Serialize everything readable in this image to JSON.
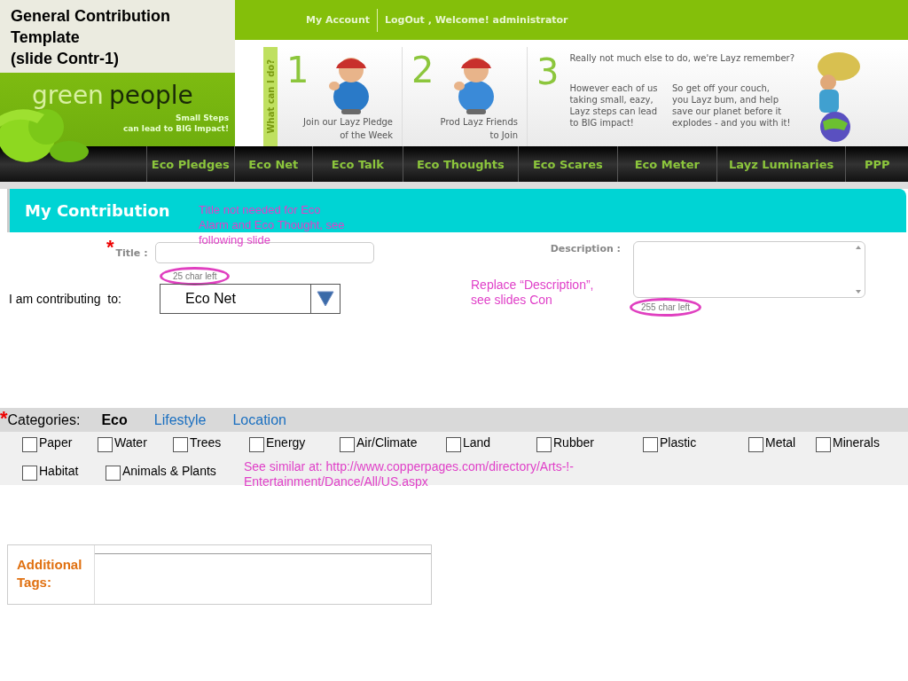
{
  "slide_title": [
    "General Contribution",
    "Template",
    "(slide Contr-1)"
  ],
  "header": {
    "top_links": [
      "My Account",
      "LogOut , Welcome! administrator"
    ],
    "logo": {
      "word_1": "green",
      "word_2": "people",
      "tagline": [
        "Small Steps",
        "can lead to BIG Impact!"
      ]
    },
    "steps_label": "What can I do?",
    "steps": [
      {
        "kind": "pictured",
        "number": "1",
        "caption": [
          "Join our Layz Pledge",
          "of the Week"
        ]
      },
      {
        "kind": "pictured",
        "number": "2",
        "caption": [
          "Prod Layz Friends",
          "to Join"
        ]
      },
      {
        "kind": "text",
        "number": "3",
        "headline": "Really not much else to do, we're Layz remember?",
        "columns": [
          [
            "However each of us",
            "taking small, eazy,",
            "Layz steps can lead",
            "to BIG impact!"
          ],
          [
            "So get off your couch,",
            "you Layz bum, and help",
            "save our planet before it",
            "explodes - and you with it!"
          ]
        ]
      }
    ]
  },
  "nav": [
    "Eco Pledges",
    "Eco Net",
    "Eco Talk",
    "Eco Thoughts",
    "Eco Scares",
    "Eco Meter",
    "Layz Luminaries",
    "PPP"
  ],
  "panel_title": "My Contribution",
  "title_field": {
    "required_mark": "*",
    "label": "Title :",
    "counter": "25 char left"
  },
  "contributing": {
    "label": "I am contributing  to:",
    "value": "Eco Net"
  },
  "description": {
    "label": "Description :",
    "counter": "255 char left"
  },
  "categories": {
    "required_mark": "*",
    "label": "Categories:",
    "tabs": [
      {
        "label": "Eco",
        "selected": true
      },
      {
        "label": "Lifestyle",
        "selected": false
      },
      {
        "label": "Location",
        "selected": false
      }
    ],
    "options": [
      {
        "label": "Paper",
        "checked": false
      },
      {
        "label": "Water",
        "checked": false
      },
      {
        "label": "Trees",
        "checked": false
      },
      {
        "label": "Energy",
        "checked": false
      },
      {
        "label": "Air/Climate",
        "checked": false
      },
      {
        "label": "Land",
        "checked": false
      },
      {
        "label": "Rubber",
        "checked": false
      },
      {
        "label": "Plastic",
        "checked": false
      },
      {
        "label": "Metal",
        "checked": false
      },
      {
        "label": "Minerals",
        "checked": false
      },
      {
        "label": "Habitat",
        "checked": false
      },
      {
        "label": "Animals & Plants",
        "checked": false
      }
    ]
  },
  "tags": {
    "label": "Additional Tags:"
  },
  "annotations": [
    "Title not needed for Eco Alarm and Eco Thought, see following slide",
    "Replace “Description”, see slides Con",
    "See  similar at: http://www.copperpages.com/directory/Arts-!-Entertainment/Dance/All/US.aspx"
  ]
}
